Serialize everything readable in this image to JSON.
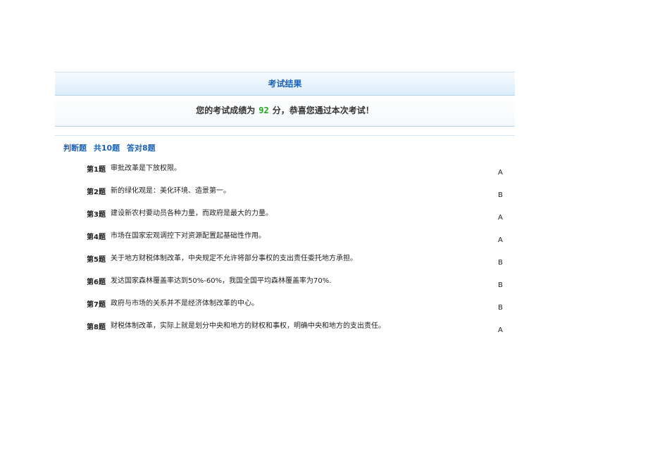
{
  "header": {
    "title": "考试结果"
  },
  "score": {
    "prefix": "您的考试成绩为",
    "value": "92",
    "suffix": "分，恭喜您通过本次考试！"
  },
  "section": {
    "type": "判断题",
    "total": "共10题",
    "correct": "答对8题"
  },
  "questions": [
    {
      "num": "第1题",
      "text": "审批改革是下放权限。",
      "answer": "A"
    },
    {
      "num": "第2题",
      "text": "新的绿化观是：美化环境、造景第一。",
      "answer": "B"
    },
    {
      "num": "第3题",
      "text": "建设新农村要动员各种力量，而政府是最大的力量。",
      "answer": "A"
    },
    {
      "num": "第4题",
      "text": "市场在国家宏观调控下对资源配置起基础性作用。",
      "answer": "A"
    },
    {
      "num": "第5题",
      "text": "关于地方财税体制改革，中央规定不允许将部分事权的支出责任委托地方承担。",
      "answer": "B"
    },
    {
      "num": "第6题",
      "text": "发达国家森林覆盖率达到50%-60%，我国全国平均森林覆盖率为70%.",
      "answer": "B"
    },
    {
      "num": "第7题",
      "text": "政府与市场的关系并不是经济体制改革的中心。",
      "answer": "B"
    },
    {
      "num": "第8题",
      "text": "财税体制改革，实际上就是划分中央和地方的财权和事权，明确中央和地方的支出责任。",
      "answer": "A"
    }
  ]
}
